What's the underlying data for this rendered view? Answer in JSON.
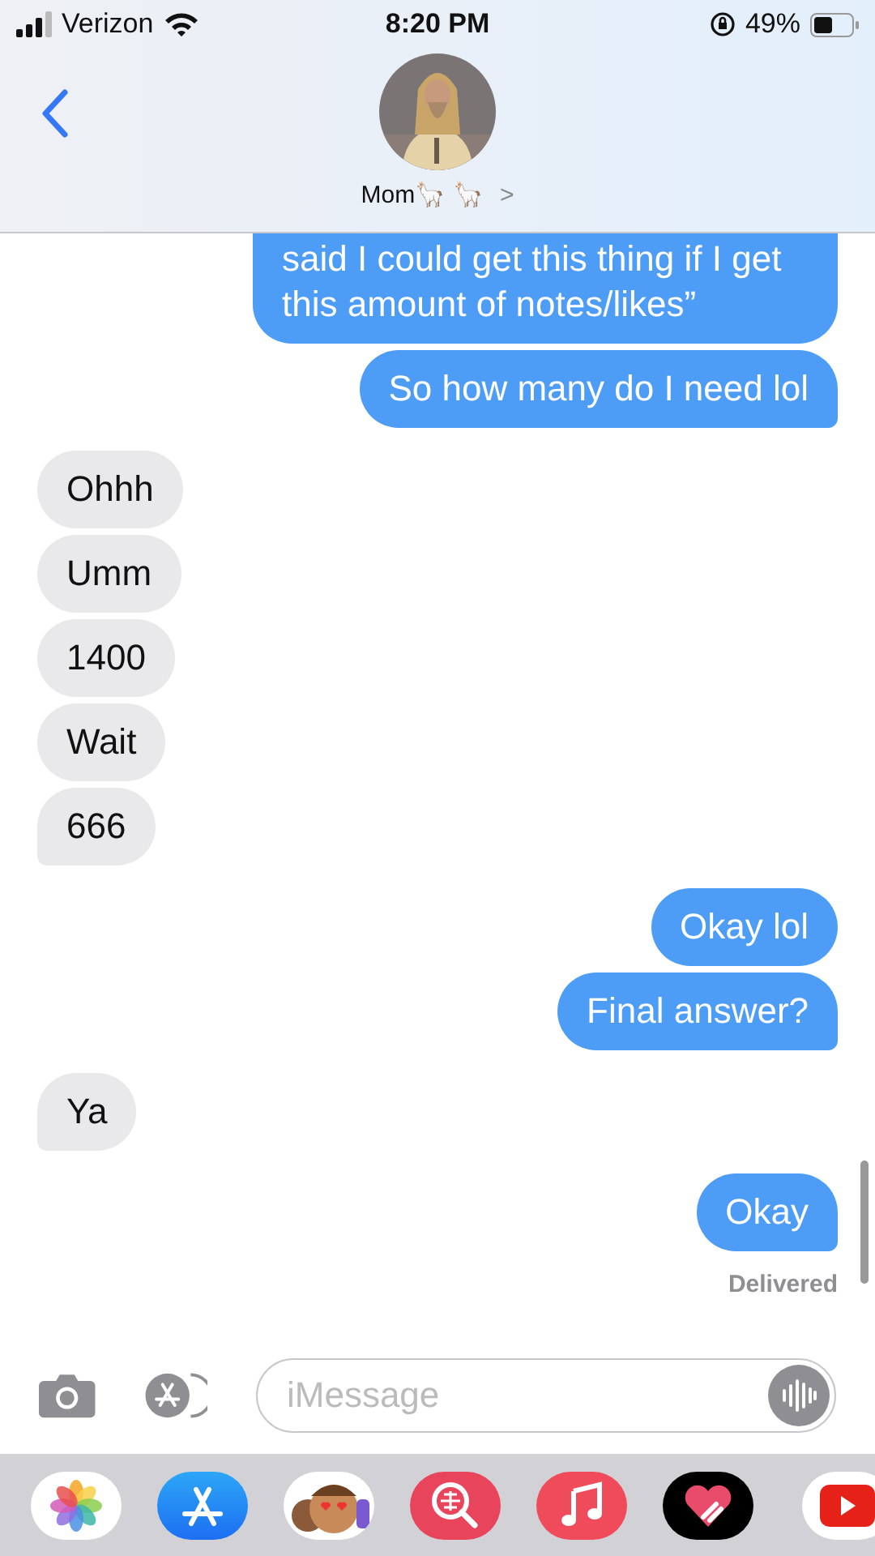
{
  "status_bar": {
    "carrier": "Verizon",
    "time": "8:20 PM",
    "battery": "49%"
  },
  "header": {
    "contact": "Mom🦙 🦙",
    "chevron": ">"
  },
  "messages": [
    {
      "kind": "sent",
      "text": "said I could get this thing if I get this amount of notes/likes”",
      "tail": false,
      "cut_top": true
    },
    {
      "kind": "sent",
      "text": "So how many do I need lol",
      "tail": true,
      "cut_top": false
    },
    {
      "kind": "received",
      "text": "Ohhh",
      "tail": false,
      "cut_top": false
    },
    {
      "kind": "received",
      "text": "Umm",
      "tail": false,
      "cut_top": false
    },
    {
      "kind": "received",
      "text": "1400",
      "tail": false,
      "cut_top": false
    },
    {
      "kind": "received",
      "text": "Wait",
      "tail": false,
      "cut_top": false
    },
    {
      "kind": "received",
      "text": "666",
      "tail": true,
      "cut_top": false
    },
    {
      "kind": "sent",
      "text": "Okay lol",
      "tail": false,
      "cut_top": false
    },
    {
      "kind": "sent",
      "text": "Final answer?",
      "tail": true,
      "cut_top": false
    },
    {
      "kind": "received",
      "text": "Ya",
      "tail": true,
      "cut_top": false
    },
    {
      "kind": "sent",
      "text": "Okay",
      "tail": true,
      "cut_top": false
    }
  ],
  "receipt": "Delivered",
  "composer": {
    "placeholder": "iMessage"
  },
  "dock": [
    {
      "kind": "photos"
    },
    {
      "kind": "appstore"
    },
    {
      "kind": "memoji"
    },
    {
      "kind": "search"
    },
    {
      "kind": "music"
    },
    {
      "kind": "heart"
    },
    {
      "kind": "youtube"
    }
  ]
}
